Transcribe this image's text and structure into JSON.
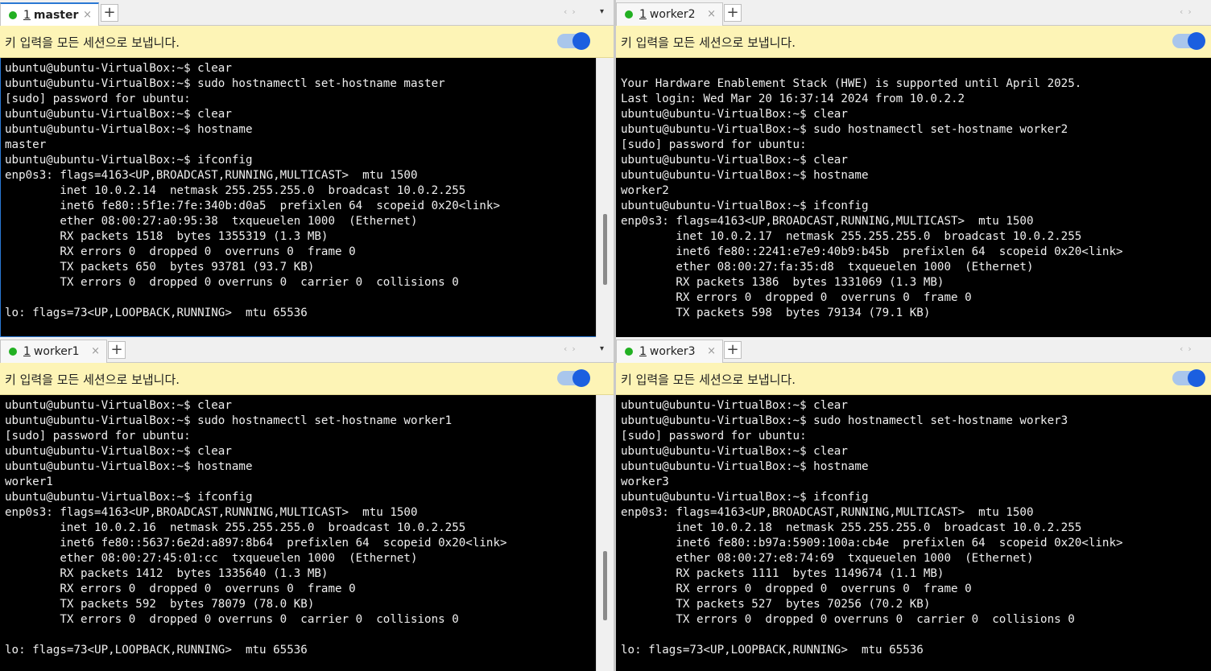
{
  "infobar_text": "키 입력을 모든 세션으로 보냅니다.",
  "icons": {
    "close": "×",
    "add": "+",
    "prev": "‹",
    "next": "›",
    "menu": "▾"
  },
  "colors": {
    "active_border": "#2a78d4",
    "status_dot": "#22b022",
    "infobar_bg": "#fdf4b6",
    "toggle_on": "#1b5fe0",
    "terminal_bg": "#000000"
  },
  "panes": {
    "master": {
      "tab_number": "1",
      "tab_name": "master",
      "lines": [
        "ubuntu@ubuntu-VirtualBox:~$ clear",
        "ubuntu@ubuntu-VirtualBox:~$ sudo hostnamectl set-hostname master",
        "[sudo] password for ubuntu:",
        "ubuntu@ubuntu-VirtualBox:~$ clear",
        "ubuntu@ubuntu-VirtualBox:~$ hostname",
        "master",
        "ubuntu@ubuntu-VirtualBox:~$ ifconfig",
        "enp0s3: flags=4163<UP,BROADCAST,RUNNING,MULTICAST>  mtu 1500",
        "        inet 10.0.2.14  netmask 255.255.255.0  broadcast 10.0.2.255",
        "        inet6 fe80::5f1e:7fe:340b:d0a5  prefixlen 64  scopeid 0x20<link>",
        "        ether 08:00:27:a0:95:38  txqueuelen 1000  (Ethernet)",
        "        RX packets 1518  bytes 1355319 (1.3 MB)",
        "        RX errors 0  dropped 0  overruns 0  frame 0",
        "        TX packets 650  bytes 93781 (93.7 KB)",
        "        TX errors 0  dropped 0 overruns 0  carrier 0  collisions 0",
        "",
        "lo: flags=73<UP,LOOPBACK,RUNNING>  mtu 65536"
      ]
    },
    "worker2": {
      "tab_number": "1",
      "tab_name": "worker2",
      "lines": [
        "",
        "Your Hardware Enablement Stack (HWE) is supported until April 2025.",
        "Last login: Wed Mar 20 16:37:14 2024 from 10.0.2.2",
        "ubuntu@ubuntu-VirtualBox:~$ clear",
        "ubuntu@ubuntu-VirtualBox:~$ sudo hostnamectl set-hostname worker2",
        "[sudo] password for ubuntu:",
        "ubuntu@ubuntu-VirtualBox:~$ clear",
        "ubuntu@ubuntu-VirtualBox:~$ hostname",
        "worker2",
        "ubuntu@ubuntu-VirtualBox:~$ ifconfig",
        "enp0s3: flags=4163<UP,BROADCAST,RUNNING,MULTICAST>  mtu 1500",
        "        inet 10.0.2.17  netmask 255.255.255.0  broadcast 10.0.2.255",
        "        inet6 fe80::2241:e7e9:40b9:b45b  prefixlen 64  scopeid 0x20<link>",
        "        ether 08:00:27:fa:35:d8  txqueuelen 1000  (Ethernet)",
        "        RX packets 1386  bytes 1331069 (1.3 MB)",
        "        RX errors 0  dropped 0  overruns 0  frame 0",
        "        TX packets 598  bytes 79134 (79.1 KB)"
      ]
    },
    "worker1": {
      "tab_number": "1",
      "tab_name": "worker1",
      "lines": [
        "ubuntu@ubuntu-VirtualBox:~$ clear",
        "ubuntu@ubuntu-VirtualBox:~$ sudo hostnamectl set-hostname worker1",
        "[sudo] password for ubuntu:",
        "ubuntu@ubuntu-VirtualBox:~$ clear",
        "ubuntu@ubuntu-VirtualBox:~$ hostname",
        "worker1",
        "ubuntu@ubuntu-VirtualBox:~$ ifconfig",
        "enp0s3: flags=4163<UP,BROADCAST,RUNNING,MULTICAST>  mtu 1500",
        "        inet 10.0.2.16  netmask 255.255.255.0  broadcast 10.0.2.255",
        "        inet6 fe80::5637:6e2d:a897:8b64  prefixlen 64  scopeid 0x20<link>",
        "        ether 08:00:27:45:01:cc  txqueuelen 1000  (Ethernet)",
        "        RX packets 1412  bytes 1335640 (1.3 MB)",
        "        RX errors 0  dropped 0  overruns 0  frame 0",
        "        TX packets 592  bytes 78079 (78.0 KB)",
        "        TX errors 0  dropped 0 overruns 0  carrier 0  collisions 0",
        "",
        "lo: flags=73<UP,LOOPBACK,RUNNING>  mtu 65536"
      ]
    },
    "worker3": {
      "tab_number": "1",
      "tab_name": "worker3",
      "lines": [
        "ubuntu@ubuntu-VirtualBox:~$ clear",
        "ubuntu@ubuntu-VirtualBox:~$ sudo hostnamectl set-hostname worker3",
        "[sudo] password for ubuntu:",
        "ubuntu@ubuntu-VirtualBox:~$ clear",
        "ubuntu@ubuntu-VirtualBox:~$ hostname",
        "worker3",
        "ubuntu@ubuntu-VirtualBox:~$ ifconfig",
        "enp0s3: flags=4163<UP,BROADCAST,RUNNING,MULTICAST>  mtu 1500",
        "        inet 10.0.2.18  netmask 255.255.255.0  broadcast 10.0.2.255",
        "        inet6 fe80::b97a:5909:100a:cb4e  prefixlen 64  scopeid 0x20<link>",
        "        ether 08:00:27:e8:74:69  txqueuelen 1000  (Ethernet)",
        "        RX packets 1111  bytes 1149674 (1.1 MB)",
        "        RX errors 0  dropped 0  overruns 0  frame 0",
        "        TX packets 527  bytes 70256 (70.2 KB)",
        "        TX errors 0  dropped 0 overruns 0  carrier 0  collisions 0",
        "",
        "lo: flags=73<UP,LOOPBACK,RUNNING>  mtu 65536"
      ]
    }
  }
}
